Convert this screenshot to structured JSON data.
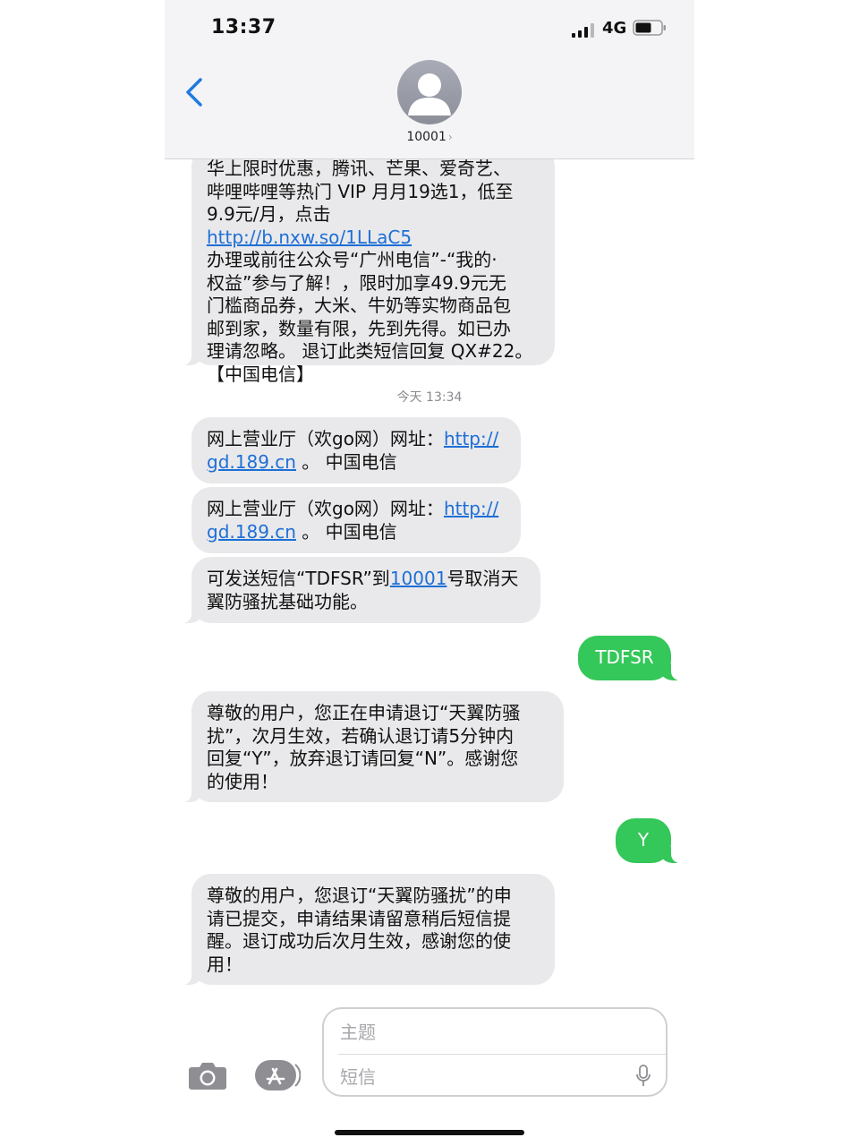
{
  "status_bar": {
    "time": "13:37",
    "network": "4G"
  },
  "header": {
    "contact": "10001",
    "chevron": "›"
  },
  "timestamp": "今天 13:34",
  "messages": [
    {
      "dir": "in",
      "lines": [
        "华上限时优惠，腾讯、芒果、爱奇艺、",
        "哔哩哔哩等热门 VIP 月月19选1，低至",
        "9.9元/月，点击 "
      ],
      "link": "http://b.nxw.so/1LLaC5",
      "tail_lines": [
        "办理或前往公众号“广州电信”-“我的·",
        "权益”参与了解！，限时加享49.9元无",
        "门槛商品券，大米、牛奶等实物商品包",
        "邮到家，数量有限，先到先得。如已办",
        "理请忽略。 退订此类短信回复 QX#22。",
        "【中国电信】"
      ]
    },
    {
      "dir": "in",
      "prefix": "网上营业厅（欢go网）网址：",
      "link1": "http://",
      "link2": "gd.189.cn",
      "suffix": " 。 中国电信"
    },
    {
      "dir": "in",
      "prefix": "网上营业厅（欢go网）网址：",
      "link1": "http://",
      "link2": "gd.189.cn",
      "suffix": " 。 中国电信"
    },
    {
      "dir": "in",
      "prefix": "可发送短信“TDFSR”到",
      "link": "10001",
      "suffix": "号取消天",
      "line2": "翼防骚扰基础功能。"
    },
    {
      "dir": "out",
      "text": "TDFSR"
    },
    {
      "dir": "in",
      "lines": [
        "尊敬的用户，您正在申请退订“天翼防骚",
        "扰”，次月生效，若确认退订请5分钟内",
        "回复“Y”，放弃退订请回复“N”。感谢您",
        "的使用！"
      ]
    },
    {
      "dir": "out",
      "text": "Y"
    },
    {
      "dir": "in",
      "lines": [
        "尊敬的用户，您退订“天翼防骚扰”的申",
        "请已提交，申请结果请留意稍后短信提",
        "醒。退订成功后次月生效，感谢您的使",
        "用！"
      ]
    }
  ],
  "compose": {
    "subject_placeholder": "主题",
    "body_placeholder": "短信"
  },
  "colors": {
    "incoming": "#e9e9eb",
    "outgoing": "#34c759",
    "link": "#1e6fd6",
    "back": "#1f7ae0"
  }
}
